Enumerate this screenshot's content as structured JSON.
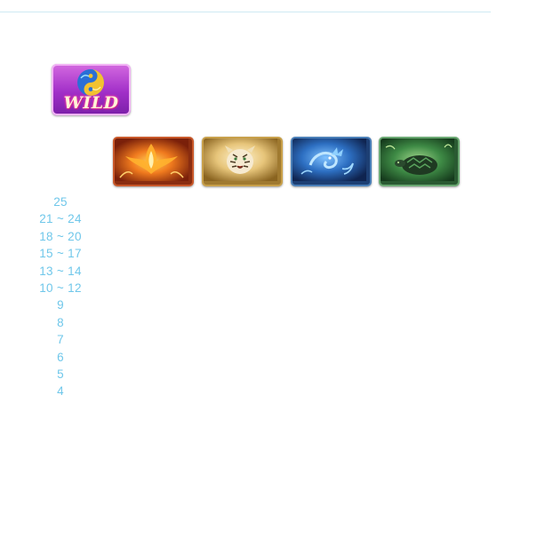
{
  "wild": {
    "label": "WILD",
    "icon": "yin-yang-fish-icon"
  },
  "symbols": [
    {
      "name": "phoenix",
      "icon": "phoenix-icon",
      "color": "#e2561c"
    },
    {
      "name": "tiger",
      "icon": "tiger-icon",
      "color": "#d9b25e"
    },
    {
      "name": "dragon",
      "icon": "dragon-icon",
      "color": "#2d6fc2"
    },
    {
      "name": "tortoise",
      "icon": "tortoise-icon",
      "color": "#3e8a45"
    }
  ],
  "counts": [
    "25",
    "21 ~ 24",
    "18 ~ 20",
    "15 ~ 17",
    "13 ~ 14",
    "10 ~ 12",
    "9",
    "8",
    "7",
    "6",
    "5",
    "4"
  ],
  "colors": {
    "count_text": "#6fc7ea",
    "divider": "#cfeaf3",
    "wild_tile": "#a12fc8"
  }
}
